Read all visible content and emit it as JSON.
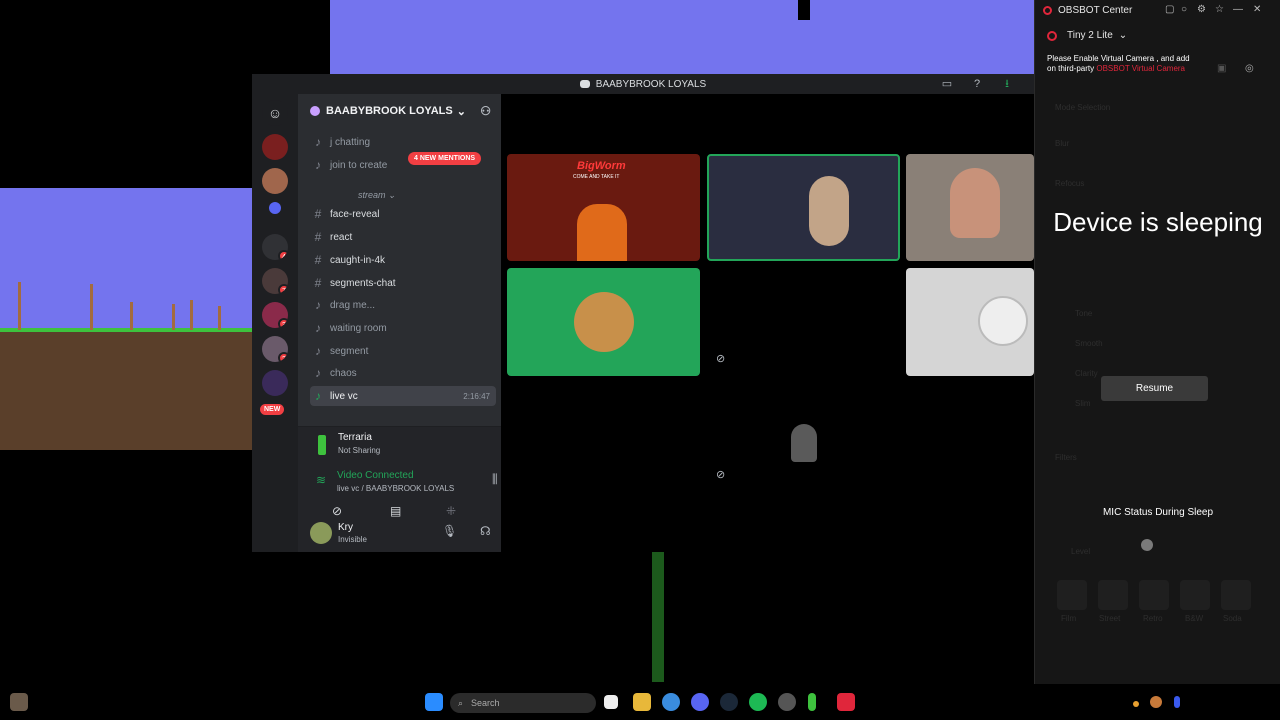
{
  "discord": {
    "window_title": "BAABYBROOK LOYALS",
    "server_name": "BAABYBROOK LOYALS",
    "mentions_pill": "4 NEW MENTIONS",
    "server_badges": [
      "4",
      "7",
      "3",
      "2"
    ],
    "new_badge": "NEW",
    "category": "stream",
    "channels": [
      {
        "label": "j chatting",
        "kind": "voice"
      },
      {
        "label": "join to create",
        "kind": "voice"
      },
      {
        "label": "face-reveal",
        "kind": "text"
      },
      {
        "label": "react",
        "kind": "text"
      },
      {
        "label": "caught-in-4k",
        "kind": "text"
      },
      {
        "label": "segments-chat",
        "kind": "text"
      },
      {
        "label": "drag me...",
        "kind": "voice"
      },
      {
        "label": "waiting room",
        "kind": "voice"
      },
      {
        "label": "segment",
        "kind": "voice"
      },
      {
        "label": "chaos",
        "kind": "voice"
      },
      {
        "label": "live vc",
        "kind": "voice"
      }
    ],
    "live_time": "2:16:47",
    "activity": {
      "title": "Terraria",
      "status": "Not Sharing"
    },
    "voice": {
      "status": "Video Connected",
      "channel": "live vc / BAABYBROOK LOYALS"
    },
    "user": {
      "name": "Kry",
      "status": "Invisible"
    },
    "tile_text": "BigWorm",
    "tile_sub": "COME AND TAKE IT"
  },
  "obsbot": {
    "app_title": "OBSBOT Center",
    "device": "Tiny 2 Lite",
    "notice": "Please Enable Virtual Camera , and add on third-party",
    "notice_link": "OBSBOT Virtual Camera",
    "sleep_title": "Device is sleeping",
    "resume_label": "Resume",
    "mic_status": "MIC Status During Sleep",
    "ghost_labels": [
      "Mode Selection",
      "Blur",
      "Refocus",
      "Tone",
      "Smooth",
      "Clarity",
      "Slim",
      "Filters",
      "Level",
      "Film",
      "Street",
      "Retro",
      "B&W",
      "Soda"
    ]
  },
  "taskbar": {
    "search_placeholder": "Search"
  },
  "colors": {
    "discord_bg": "#1e1f22",
    "channel_bg": "#2b2d31",
    "green": "#23a559",
    "red": "#f23f43",
    "obsbot_red": "#e0263b",
    "terraria_sky": "#7474ee"
  }
}
